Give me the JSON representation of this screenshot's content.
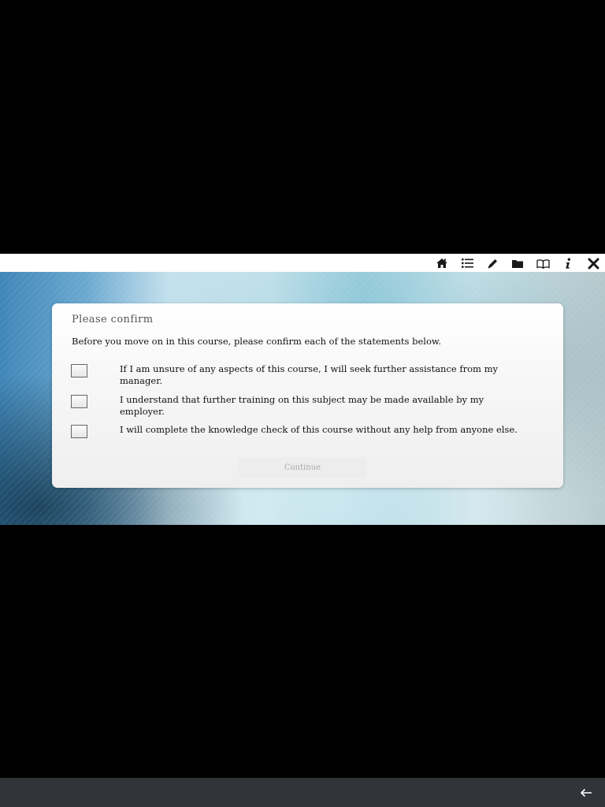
{
  "toolbar": {
    "items": [
      {
        "name": "home",
        "icon": "home-icon"
      },
      {
        "name": "menu",
        "icon": "list-icon"
      },
      {
        "name": "notes",
        "icon": "pencil-icon"
      },
      {
        "name": "resources",
        "icon": "folder-icon"
      },
      {
        "name": "glossary",
        "icon": "book-icon"
      },
      {
        "name": "info",
        "icon": "info-icon"
      },
      {
        "name": "exit",
        "icon": "close-icon"
      }
    ]
  },
  "dialog": {
    "title": "Please confirm",
    "intro": "Before you move on in this course, please confirm each of the statements below.",
    "statements": [
      {
        "text": "If I am unsure of any aspects of this course, I will seek further assistance from my manager.",
        "checked": false
      },
      {
        "text": "I understand that further training on this subject may be made available by my employer.",
        "checked": false
      },
      {
        "text": "I will complete the knowledge check of this course without any help from anyone else.",
        "checked": false
      }
    ],
    "continue_label": "Continue"
  },
  "system_bar": {
    "back_icon": "arrow-left-icon"
  },
  "colors": {
    "background": "#000000",
    "toolbar_bg": "#ffffff",
    "system_bar_bg": "#313539",
    "icon_color": "#1a1a1a"
  }
}
